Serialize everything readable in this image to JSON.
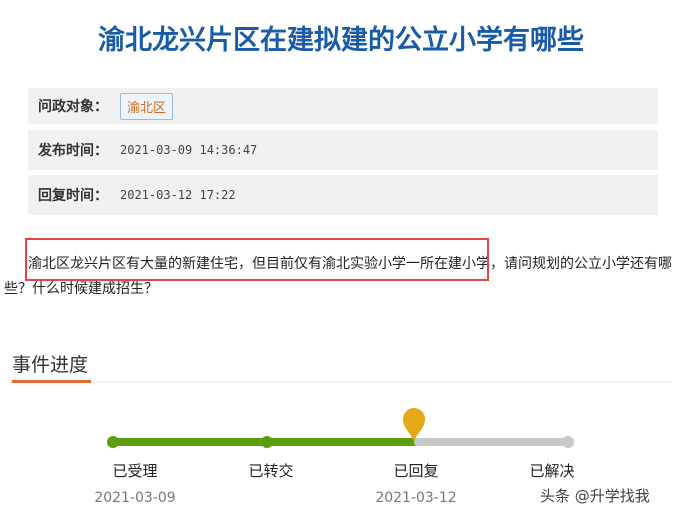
{
  "title": "渝北龙兴片区在建拟建的公立小学有哪些",
  "info": [
    {
      "label": "问政对象：",
      "tag": "渝北区"
    },
    {
      "label": "发布时间：",
      "value": "2021-03-09 14:36:47"
    },
    {
      "label": "回复时间：",
      "value": "2021-03-12 17:22"
    }
  ],
  "question": "渝北区龙兴片区有大量的新建住宅，但目前仅有渝北实验小学一所在建小学，请问规划的公立小学还有哪些？什么时候建成招生？",
  "progress": {
    "heading": "事件进度",
    "steps": [
      {
        "label": "已受理",
        "date": "2021-03-09"
      },
      {
        "label": "已转交",
        "date": ""
      },
      {
        "label": "已回复",
        "date": "2021-03-12"
      },
      {
        "label": "已解决",
        "date": ""
      }
    ],
    "current_step": 2,
    "colors": {
      "done": "#5a9e0f",
      "pending": "#c8c8c8",
      "current": "#e6a817"
    }
  },
  "watermark": "头条 @升学找我"
}
